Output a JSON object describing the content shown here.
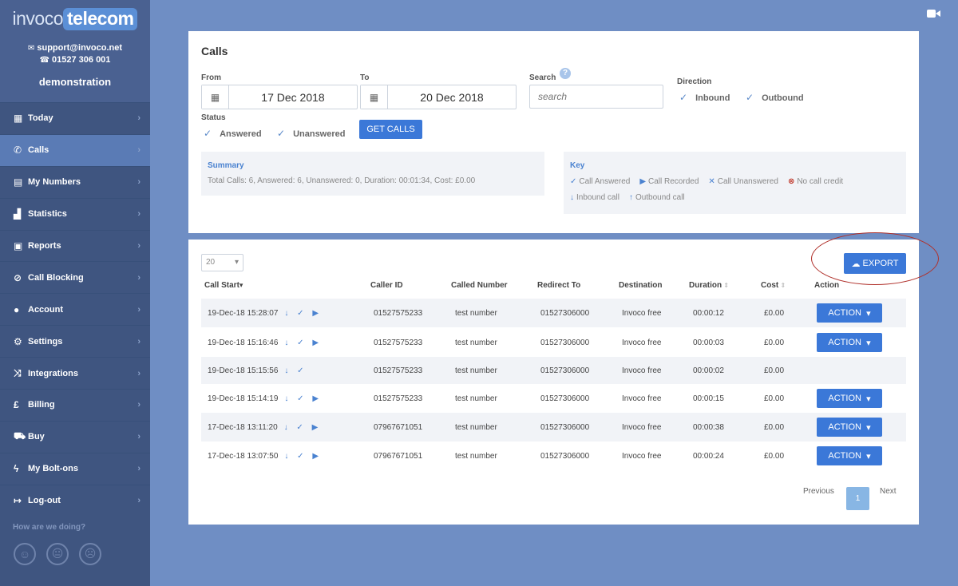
{
  "brand": {
    "logo_part1": "invoco",
    "logo_part2": "telecom"
  },
  "contact": {
    "email": "support@invoco.net",
    "phone": "01527 306 001",
    "account": "demonstration"
  },
  "nav": [
    {
      "label": "Today",
      "icon": "calendar-icon",
      "glyph": "▦"
    },
    {
      "label": "Calls",
      "icon": "phone-icon",
      "glyph": "✆"
    },
    {
      "label": "My Numbers",
      "icon": "numbers-icon",
      "glyph": "▤"
    },
    {
      "label": "Statistics",
      "icon": "chart-icon",
      "glyph": "▟"
    },
    {
      "label": "Reports",
      "icon": "reports-icon",
      "glyph": "▣"
    },
    {
      "label": "Call Blocking",
      "icon": "block-icon",
      "glyph": "⊘"
    },
    {
      "label": "Account",
      "icon": "user-icon",
      "glyph": "●"
    },
    {
      "label": "Settings",
      "icon": "gear-icon",
      "glyph": "⚙"
    },
    {
      "label": "Integrations",
      "icon": "shuffle-icon",
      "glyph": "⤨"
    },
    {
      "label": "Billing",
      "icon": "pound-icon",
      "glyph": "£"
    },
    {
      "label": "Buy",
      "icon": "cart-icon",
      "glyph": "⛟"
    },
    {
      "label": "My Bolt-ons",
      "icon": "bolt-icon",
      "glyph": "ϟ"
    },
    {
      "label": "Log-out",
      "icon": "logout-icon",
      "glyph": "↦"
    }
  ],
  "feedback": {
    "label": "How are we doing?"
  },
  "calls": {
    "title": "Calls",
    "from_label": "From",
    "from_value": "17 Dec 2018",
    "to_label": "To",
    "to_value": "20 Dec 2018",
    "search_label": "Search",
    "search_placeholder": "search",
    "direction_label": "Direction",
    "inbound": "Inbound",
    "outbound": "Outbound",
    "status_label": "Status",
    "answered": "Answered",
    "unanswered": "Unanswered",
    "get_calls": "GET CALLS"
  },
  "summary": {
    "title": "Summary",
    "text": "Total Calls: 6, Answered: 6, Unanswered: 0, Duration: 00:01:34, Cost: £0.00"
  },
  "key": {
    "title": "Key",
    "call_answered": "Call Answered",
    "call_recorded": "Call Recorded",
    "call_unanswered": "Call Unanswered",
    "no_call_credit": "No call credit",
    "inbound_call": "Inbound call",
    "outbound_call": "Outbound call"
  },
  "table": {
    "page_size": "20",
    "export": "EXPORT",
    "headers": {
      "call_start": "Call Start",
      "caller_id": "Caller ID",
      "called_number": "Called Number",
      "redirect_to": "Redirect To",
      "destination": "Destination",
      "duration": "Duration",
      "cost": "Cost",
      "action": "Action"
    },
    "action_label": "ACTION",
    "rows": [
      {
        "start": "19-Dec-18 15:28:07",
        "caller": "01527575233",
        "called": "test number",
        "redirect": "01527306000",
        "dest": "Invoco free",
        "duration": "00:00:12",
        "cost": "£0.00"
      },
      {
        "start": "19-Dec-18 15:16:46",
        "caller": "01527575233",
        "called": "test number",
        "redirect": "01527306000",
        "dest": "Invoco free",
        "duration": "00:00:03",
        "cost": "£0.00"
      },
      {
        "start": "19-Dec-18 15:15:56",
        "caller": "01527575233",
        "called": "test number",
        "redirect": "01527306000",
        "dest": "Invoco free",
        "duration": "00:00:02",
        "cost": "£0.00"
      },
      {
        "start": "19-Dec-18 15:14:19",
        "caller": "01527575233",
        "called": "test number",
        "redirect": "01527306000",
        "dest": "Invoco free",
        "duration": "00:00:15",
        "cost": "£0.00"
      },
      {
        "start": "17-Dec-18 13:11:20",
        "caller": "07967671051",
        "called": "test number",
        "redirect": "01527306000",
        "dest": "Invoco free",
        "duration": "00:00:38",
        "cost": "£0.00"
      },
      {
        "start": "17-Dec-18 13:07:50",
        "caller": "07967671051",
        "called": "test number",
        "redirect": "01527306000",
        "dest": "Invoco free",
        "duration": "00:00:24",
        "cost": "£0.00"
      }
    ],
    "pager": {
      "previous": "Previous",
      "current": "1",
      "next": "Next"
    }
  },
  "colors": {
    "accent": "#3b78d8",
    "sidebar": "#3f5580",
    "background": "#6f8ec4"
  }
}
